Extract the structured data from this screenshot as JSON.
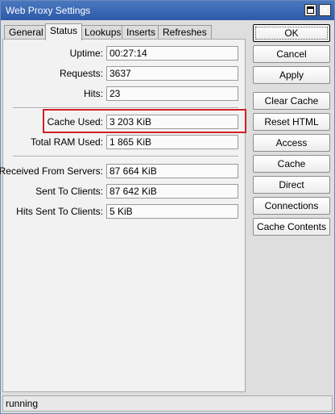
{
  "window": {
    "title": "Web Proxy Settings"
  },
  "tabs": [
    "General",
    "Status",
    "Lookups",
    "Inserts",
    "Refreshes"
  ],
  "status": {
    "uptime_label": "Uptime:",
    "uptime": "00:27:14",
    "requests_label": "Requests:",
    "requests": "3637",
    "hits_label": "Hits:",
    "hits": "23",
    "cache_used_label": "Cache Used:",
    "cache_used": "3 203 KiB",
    "total_ram_label": "Total RAM Used:",
    "total_ram": "1 865 KiB",
    "received_label": "Received From Servers:",
    "received": "87 664 KiB",
    "sent_label": "Sent To Clients:",
    "sent": "87 642 KiB",
    "hits_sent_label": "Hits Sent To Clients:",
    "hits_sent": "5 KiB"
  },
  "buttons": {
    "ok": "OK",
    "cancel": "Cancel",
    "apply": "Apply",
    "clear_cache": "Clear Cache",
    "reset_html": "Reset HTML",
    "access": "Access",
    "cache": "Cache",
    "direct": "Direct",
    "connections": "Connections",
    "cache_contents": "Cache Contents"
  },
  "statusbar": {
    "text": "running"
  },
  "colors": {
    "highlight": "#d21f26",
    "titlebar": "#2c5aa8"
  }
}
